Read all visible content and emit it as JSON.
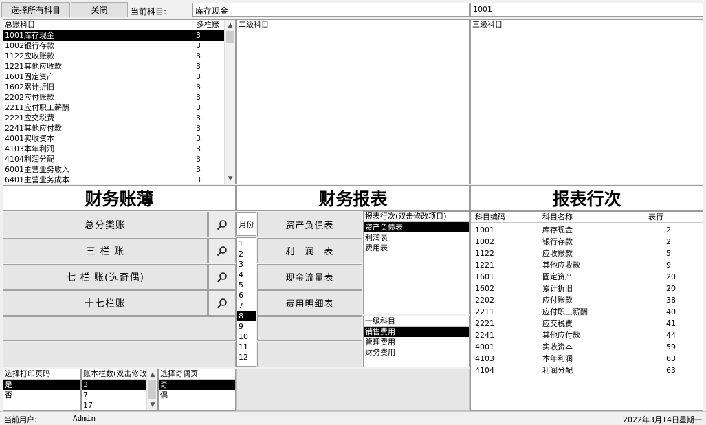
{
  "toolbar": {
    "select_all_label": "选择所有科目",
    "close_label": "关闭",
    "current_subject_label": "当前科目:",
    "current_subject_value": "库存现金",
    "current_code_value": "1001"
  },
  "gl_list": {
    "col_subject": "总账科目",
    "col_multi": "多栏账",
    "items": [
      {
        "name": "1001库存现金",
        "v": "3"
      },
      {
        "name": "1002银行存款",
        "v": "3"
      },
      {
        "name": "1122应收账款",
        "v": "3"
      },
      {
        "name": "1221其他应收款",
        "v": "3"
      },
      {
        "name": "1601固定资产",
        "v": "3"
      },
      {
        "name": "1602累计折旧",
        "v": "3"
      },
      {
        "name": "2202应付账款",
        "v": "3"
      },
      {
        "name": "2211应付职工薪酬",
        "v": "3"
      },
      {
        "name": "2221应交税费",
        "v": "3"
      },
      {
        "name": "2241其他应付款",
        "v": "3"
      },
      {
        "name": "4001实收资本",
        "v": "3"
      },
      {
        "name": "4103本年利润",
        "v": "3"
      },
      {
        "name": "4104利润分配",
        "v": "3"
      },
      {
        "name": "6001主营业务收入",
        "v": "3"
      },
      {
        "name": "6401主营业务成本",
        "v": "3"
      }
    ]
  },
  "level2": {
    "header": "二级科目"
  },
  "level3": {
    "header": "三级科目"
  },
  "sections": {
    "books": "财务账薄",
    "reports": "财务报表",
    "rows": "报表行次"
  },
  "ledgers": [
    "总分类账",
    "三 栏 账",
    "七 栏 账(选奇偶)",
    "十七栏账"
  ],
  "month": {
    "label": "月份",
    "items": [
      "1",
      "2",
      "3",
      "4",
      "5",
      "6",
      "7",
      "8",
      "9",
      "10",
      "11",
      "12"
    ]
  },
  "report_buttons": [
    "资产负债表",
    "利　润　表",
    "现金流量表",
    "费用明细表"
  ],
  "report_list": {
    "header": "报表行次(双击修改项目)",
    "items": [
      "资产负债表",
      "利润表",
      "费用表"
    ]
  },
  "level1_list": {
    "header": "一级科目",
    "items": [
      "销售费用",
      "管理费用",
      "财务费用"
    ]
  },
  "rows_table": {
    "col_code": "科目编码",
    "col_name": "科目名称",
    "col_row": "表行",
    "rows": [
      {
        "code": "1001",
        "name": "库存现金",
        "row": "2"
      },
      {
        "code": "1002",
        "name": "银行存款",
        "row": "2"
      },
      {
        "code": "1122",
        "name": "应收账款",
        "row": "5"
      },
      {
        "code": "1221",
        "name": "其他应收款",
        "row": "9"
      },
      {
        "code": "1601",
        "name": "固定资产",
        "row": "20"
      },
      {
        "code": "1602",
        "name": "累计折旧",
        "row": "20"
      },
      {
        "code": "2202",
        "name": "应付账款",
        "row": "38"
      },
      {
        "code": "2211",
        "name": "应付职工薪酬",
        "row": "40"
      },
      {
        "code": "2221",
        "name": "应交税费",
        "row": "41"
      },
      {
        "code": "2241",
        "name": "其他应付款",
        "row": "44"
      },
      {
        "code": "4001",
        "name": "实收资本",
        "row": "59"
      },
      {
        "code": "4103",
        "name": "本年利润",
        "row": "63"
      },
      {
        "code": "4104",
        "name": "利润分配",
        "row": "63"
      }
    ]
  },
  "print_page": {
    "header": "选择打印页码",
    "items": [
      "是",
      "否"
    ]
  },
  "columns": {
    "header": "账本栏数(双击修改)",
    "items": [
      "3",
      "7",
      "17"
    ]
  },
  "odd_even": {
    "header": "选择奇偶页",
    "items": [
      "奇",
      "偶"
    ]
  },
  "status": {
    "user_label": "当前用户:",
    "user_value": "Admin",
    "date": "2022年3月14日星期一"
  },
  "icons": {
    "search": "magnifier-icon"
  }
}
